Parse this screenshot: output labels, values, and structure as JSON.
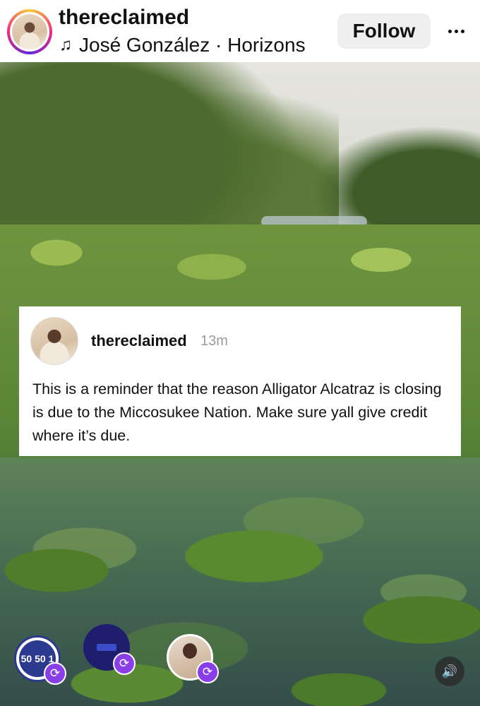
{
  "header": {
    "username": "thereclaimed",
    "music_icon": "music-note-icon",
    "music_text": "José González · Horizons",
    "follow_label": "Follow",
    "more_icon": "more-icon"
  },
  "card": {
    "username": "thereclaimed",
    "time": "13m",
    "text": "This is a reminder that the reason Alligator Alcatraz is closing is due to the Miccosukee Nation. Make sure yall give credit where it’s due."
  },
  "bottom": {
    "shares": [
      {
        "label": "50 50 1",
        "icon": "repost-icon"
      },
      {
        "label": "",
        "icon": "repost-icon"
      },
      {
        "label": "",
        "icon": "repost-icon"
      }
    ],
    "sound_icon": "speaker-icon"
  },
  "colors": {
    "follow_bg": "#efefef",
    "badge": "#8a3ee8"
  }
}
